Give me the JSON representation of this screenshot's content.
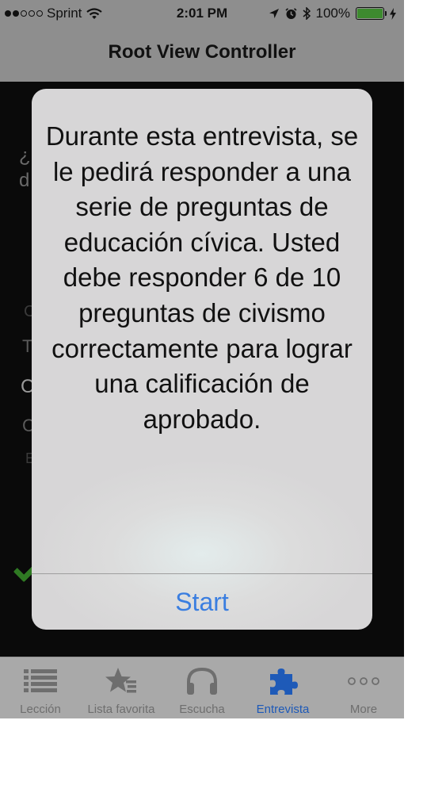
{
  "status_bar": {
    "carrier": "Sprint",
    "time": "2:01 PM",
    "battery_percent": "100%",
    "signal_bars_filled": 2,
    "signal_bars_total": 5
  },
  "nav": {
    "title": "Root View Controller"
  },
  "background_peek": {
    "line1": "¿",
    "line2": "d",
    "row1": "C",
    "row2": "T",
    "row3": "C",
    "row4": "C",
    "row5": "E"
  },
  "alert": {
    "message": "Durante esta entrevista, se le pedirá responder a una serie de preguntas de educación cívica. Usted debe responder 6 de 10 preguntas de civismo correctamente para lograr una calificación de aprobado.",
    "button": "Start"
  },
  "tabbar": {
    "active_index": 3,
    "items": [
      {
        "label": "Lección",
        "icon": "list-icon"
      },
      {
        "label": "Lista favorita",
        "icon": "star-list-icon"
      },
      {
        "label": "Escucha",
        "icon": "headphones-icon"
      },
      {
        "label": "Entrevista",
        "icon": "puzzle-icon"
      },
      {
        "label": "More",
        "icon": "more-dots-icon"
      }
    ]
  },
  "colors": {
    "accent": "#3a7ee0",
    "tab_active": "#1e5ab8",
    "battery": "#3d8a2f"
  }
}
